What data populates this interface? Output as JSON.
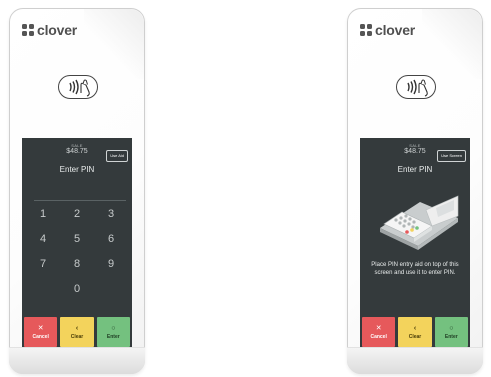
{
  "brand": {
    "name": "clover"
  },
  "left_device": {
    "sale_label": "SALE",
    "amount": "$48.75",
    "aid_button": "Use Aid",
    "prompt": "Enter PIN",
    "keys": [
      "1",
      "2",
      "3",
      "4",
      "5",
      "6",
      "7",
      "8",
      "9",
      "0"
    ],
    "actions": {
      "cancel": {
        "label": "Cancel",
        "glyph": "✕"
      },
      "clear": {
        "label": "Clear",
        "glyph": "‹"
      },
      "enter": {
        "label": "Enter",
        "glyph": "○"
      }
    }
  },
  "right_device": {
    "sale_label": "SALE",
    "amount": "$48.75",
    "aid_button": "Use Screen",
    "prompt": "Enter PIN",
    "instruction": "Place PIN entry aid on top of this screen and use it to enter PIN.",
    "actions": {
      "cancel": {
        "label": "Cancel",
        "glyph": "✕"
      },
      "clear": {
        "label": "Clear",
        "glyph": "‹"
      },
      "enter": {
        "label": "Enter",
        "glyph": "○"
      }
    }
  },
  "colors": {
    "screen_bg": "#343a3c",
    "cancel": "#e6595b",
    "clear": "#f3d35c",
    "enter": "#74c17f"
  }
}
